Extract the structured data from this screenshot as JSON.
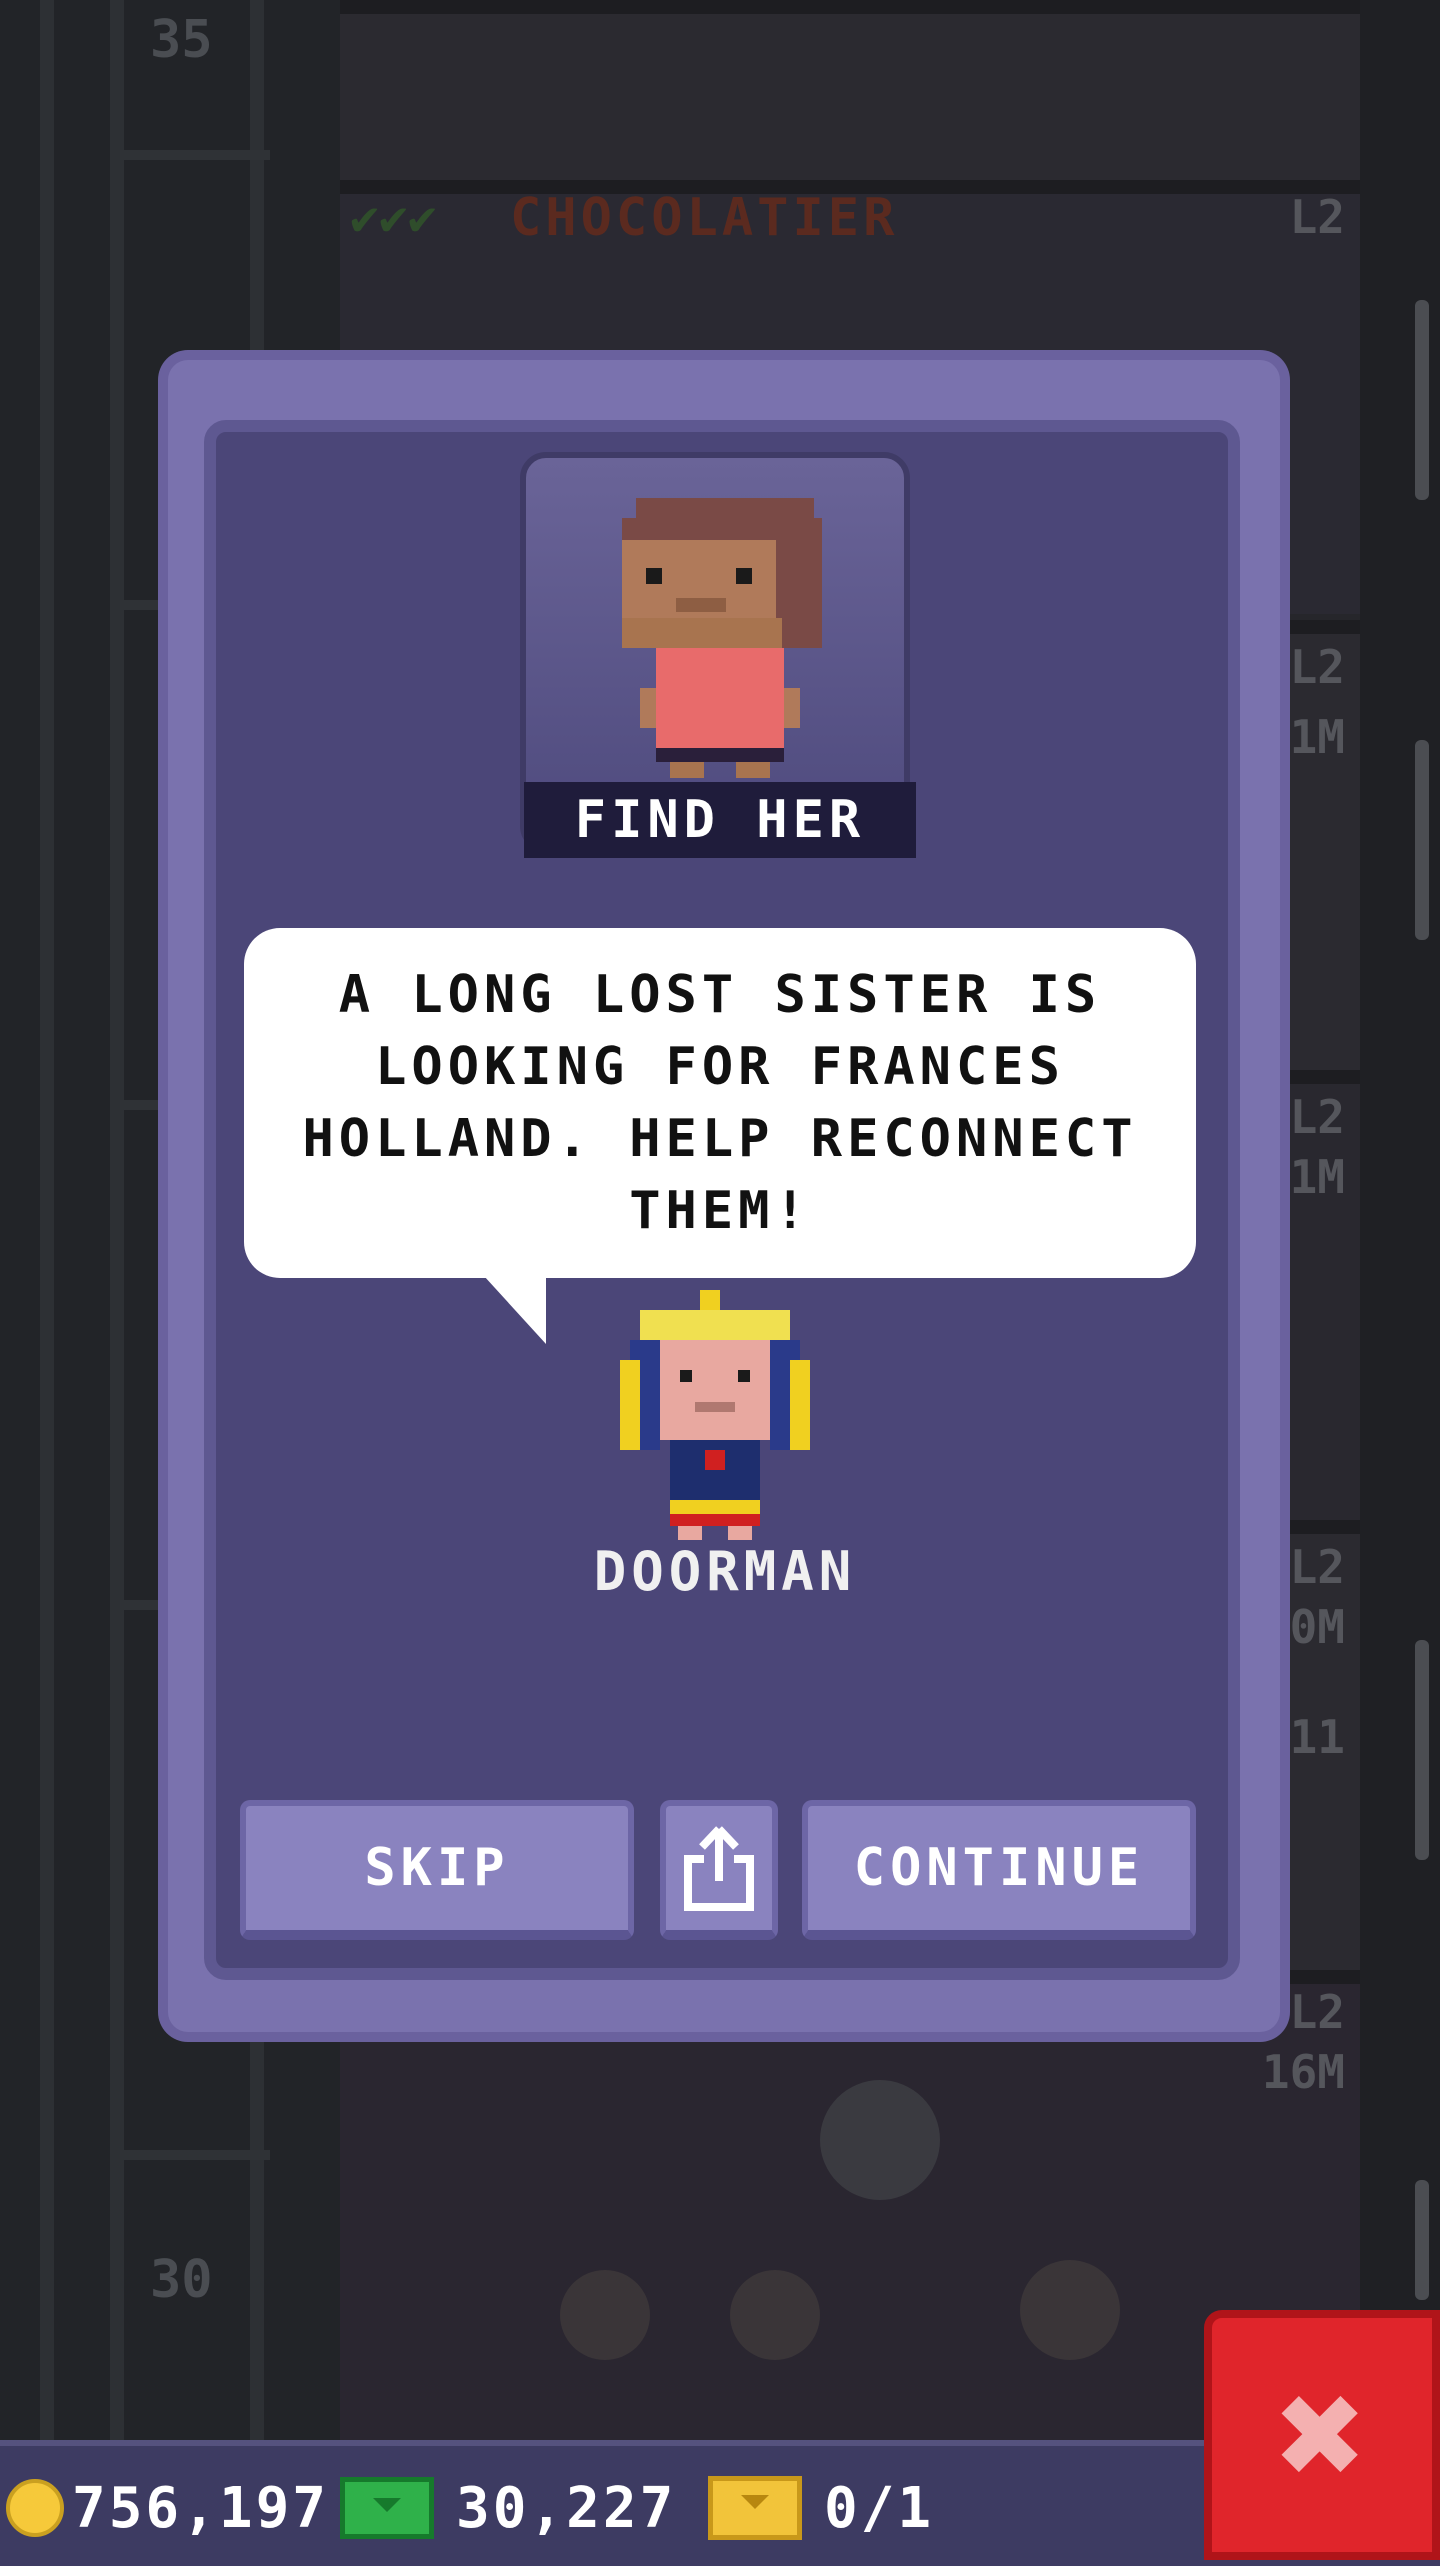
{
  "background": {
    "floor_numbers": [
      "35",
      "30"
    ],
    "shop_name": "CHOCOLATIER",
    "shop_stars": "✔✔✔",
    "level_tags": [
      "L2",
      "L2",
      "L2",
      "L2",
      "L2"
    ],
    "value_tags": [
      "1M",
      "1M",
      "0M",
      "11",
      "16M"
    ]
  },
  "modal": {
    "portrait_caption": "FIND HER",
    "message": "A LONG LOST SISTER IS LOOKING FOR FRANCES HOLLAND. HELP RECONNECT THEM!",
    "speaker_name": "DOORMAN",
    "buttons": {
      "skip": "SKIP",
      "continue": "CONTINUE",
      "share_icon": "share-icon"
    }
  },
  "hud": {
    "coins": "756,197",
    "bux": "30,227",
    "tickets": "0/1"
  },
  "close_icon": "close-icon",
  "colors": {
    "modal": "#7a72ae",
    "modal_inner": "#4b4678",
    "button": "#8a83bf",
    "close": "#e0252b",
    "hud": "#3d3b62"
  }
}
